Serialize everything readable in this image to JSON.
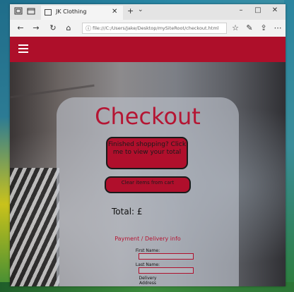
{
  "browser": {
    "tab_title": "JK Clothing",
    "tab_close": "✕",
    "new_tab": "+",
    "tab_list": "⌄",
    "address": "file:///C:/Users/Jake/Desktop/mySiteRoot/checkout.html",
    "controls": {
      "minimize": "–",
      "maximize": "□",
      "close": "✕"
    }
  },
  "nav_icons": {
    "back": "←",
    "forward": "→",
    "refresh": "↻",
    "home": "⌂",
    "favorite": "☆",
    "reading": "✎",
    "share": "⇪",
    "more": "⋯"
  },
  "page": {
    "title": "Checkout",
    "view_cart_button": "Finished shopping? Click me to view your total",
    "clear_cart_button": "Clear items from cart",
    "total_label": "Total: £",
    "payment_heading": "Payment / Delivery info",
    "fields": [
      {
        "label": "First Name:"
      },
      {
        "label": "Last Name:"
      },
      {
        "label": "Delivery Address"
      }
    ]
  },
  "colors": {
    "brand": "#ae0f2a",
    "button": "#b00f2c",
    "title": "#b51533"
  }
}
